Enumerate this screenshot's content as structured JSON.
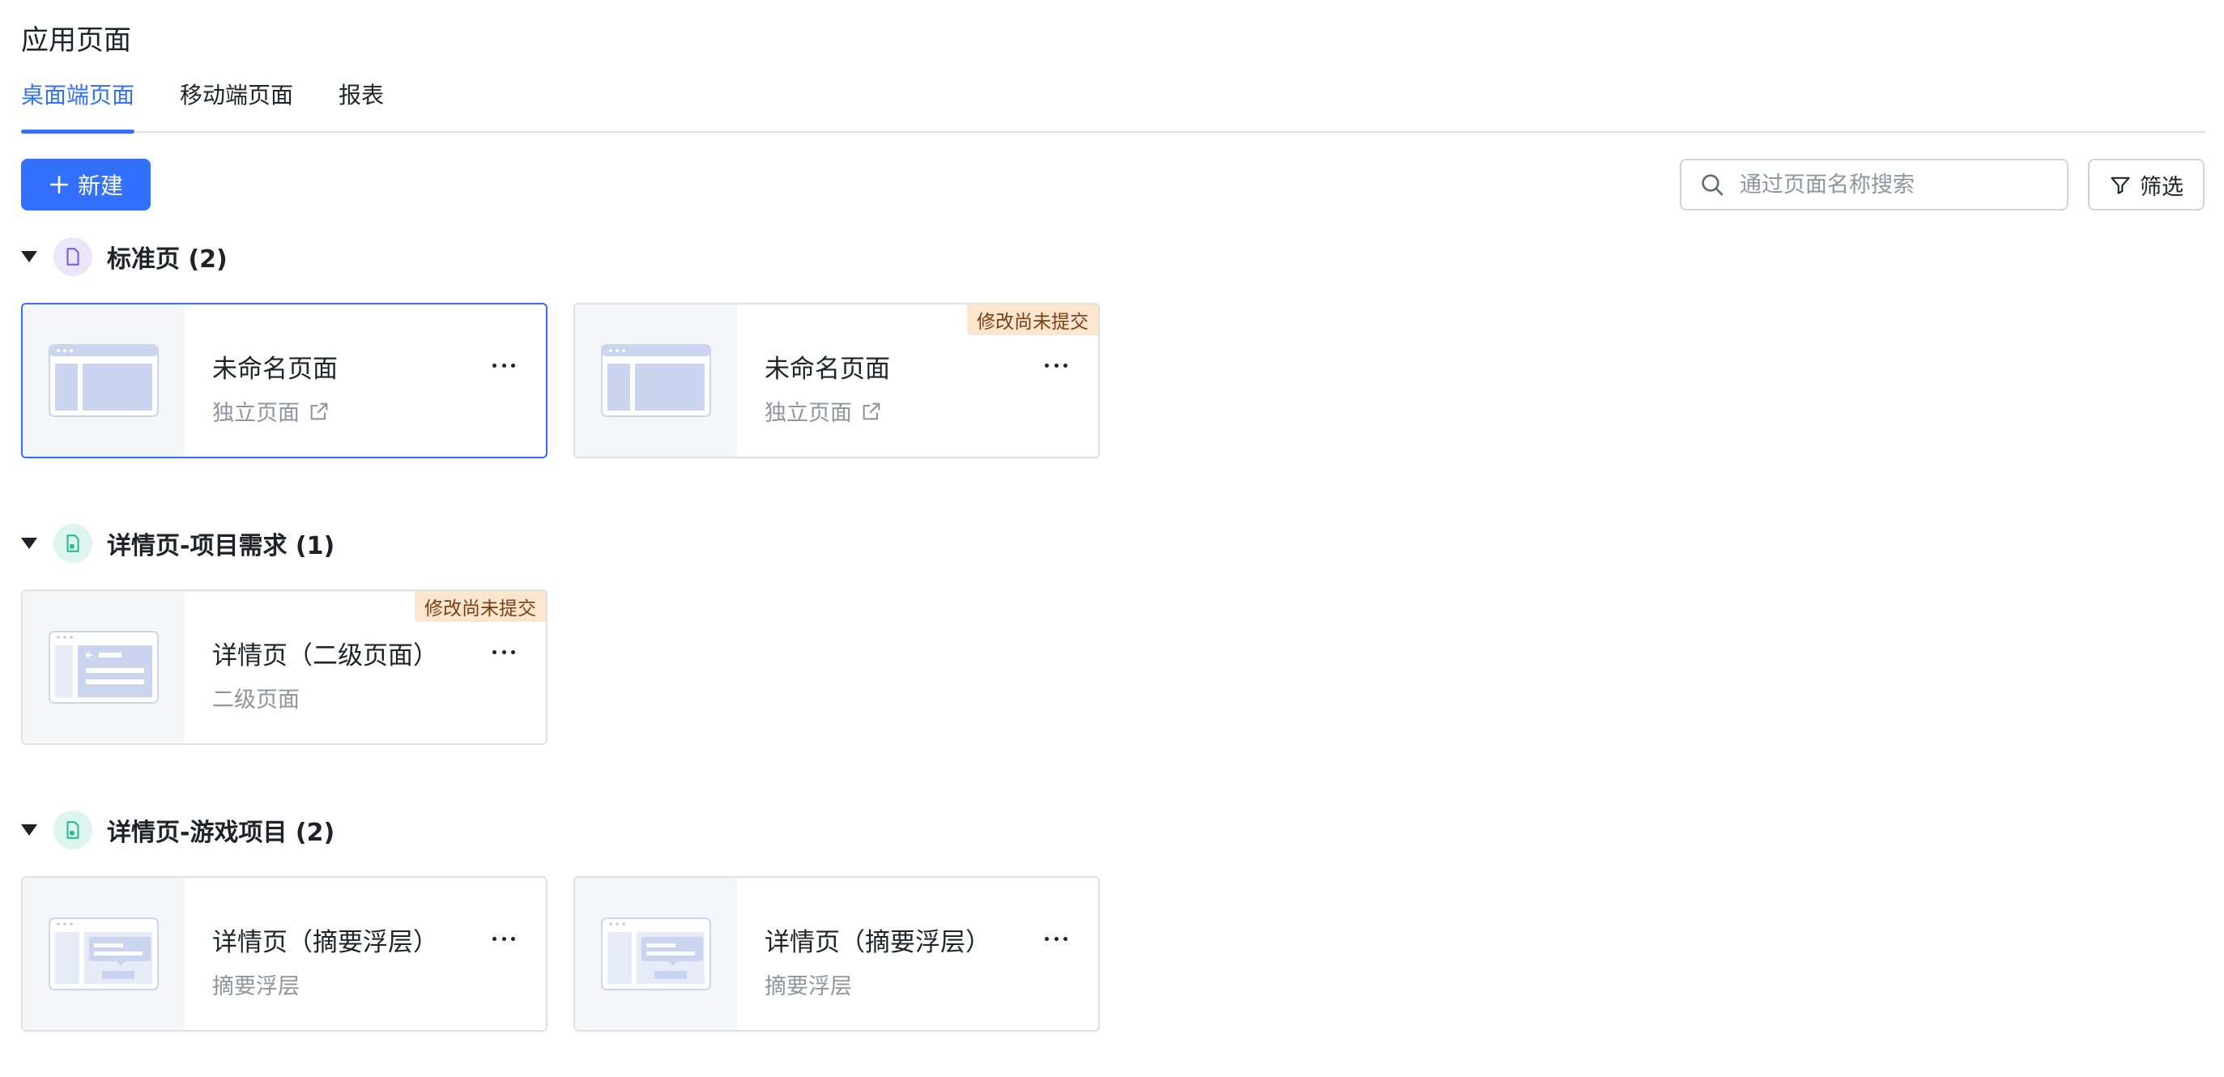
{
  "page": {
    "title": "应用页面"
  },
  "tabs": [
    {
      "label": "桌面端页面",
      "active": true
    },
    {
      "label": "移动端页面",
      "active": false
    },
    {
      "label": "报表",
      "active": false
    }
  ],
  "toolbar": {
    "new_label": "新建",
    "search_placeholder": "通过页面名称搜索",
    "filter_label": "筛选"
  },
  "groups": [
    {
      "title": "标准页 (2)",
      "icon": "page-icon",
      "cards": [
        {
          "title": "未命名页面",
          "subtitle": "独立页面",
          "external_link": true,
          "badge": "",
          "selected": true
        },
        {
          "title": "未命名页面",
          "subtitle": "独立页面",
          "external_link": true,
          "badge": "修改尚未提交",
          "selected": false
        }
      ]
    },
    {
      "title": "详情页-项目需求 (1)",
      "icon": "detail-page-icon",
      "cards": [
        {
          "title": "详情页（二级页面）",
          "subtitle": "二级页面",
          "external_link": false,
          "badge": "修改尚未提交",
          "selected": false
        }
      ]
    },
    {
      "title": "详情页-游戏项目 (2)",
      "icon": "detail-page-icon",
      "cards": [
        {
          "title": "详情页（摘要浮层）",
          "subtitle": "摘要浮层",
          "external_link": false,
          "badge": "",
          "selected": false
        },
        {
          "title": "详情页（摘要浮层）",
          "subtitle": "摘要浮层",
          "external_link": false,
          "badge": "",
          "selected": false
        }
      ]
    }
  ],
  "colors": {
    "accent": "#3370ff",
    "badge_bg": "#fde6cf",
    "badge_text": "#7a3e12",
    "standard_icon_bg": "#ece6fb",
    "detail_icon_bg": "#dcf5ef"
  }
}
